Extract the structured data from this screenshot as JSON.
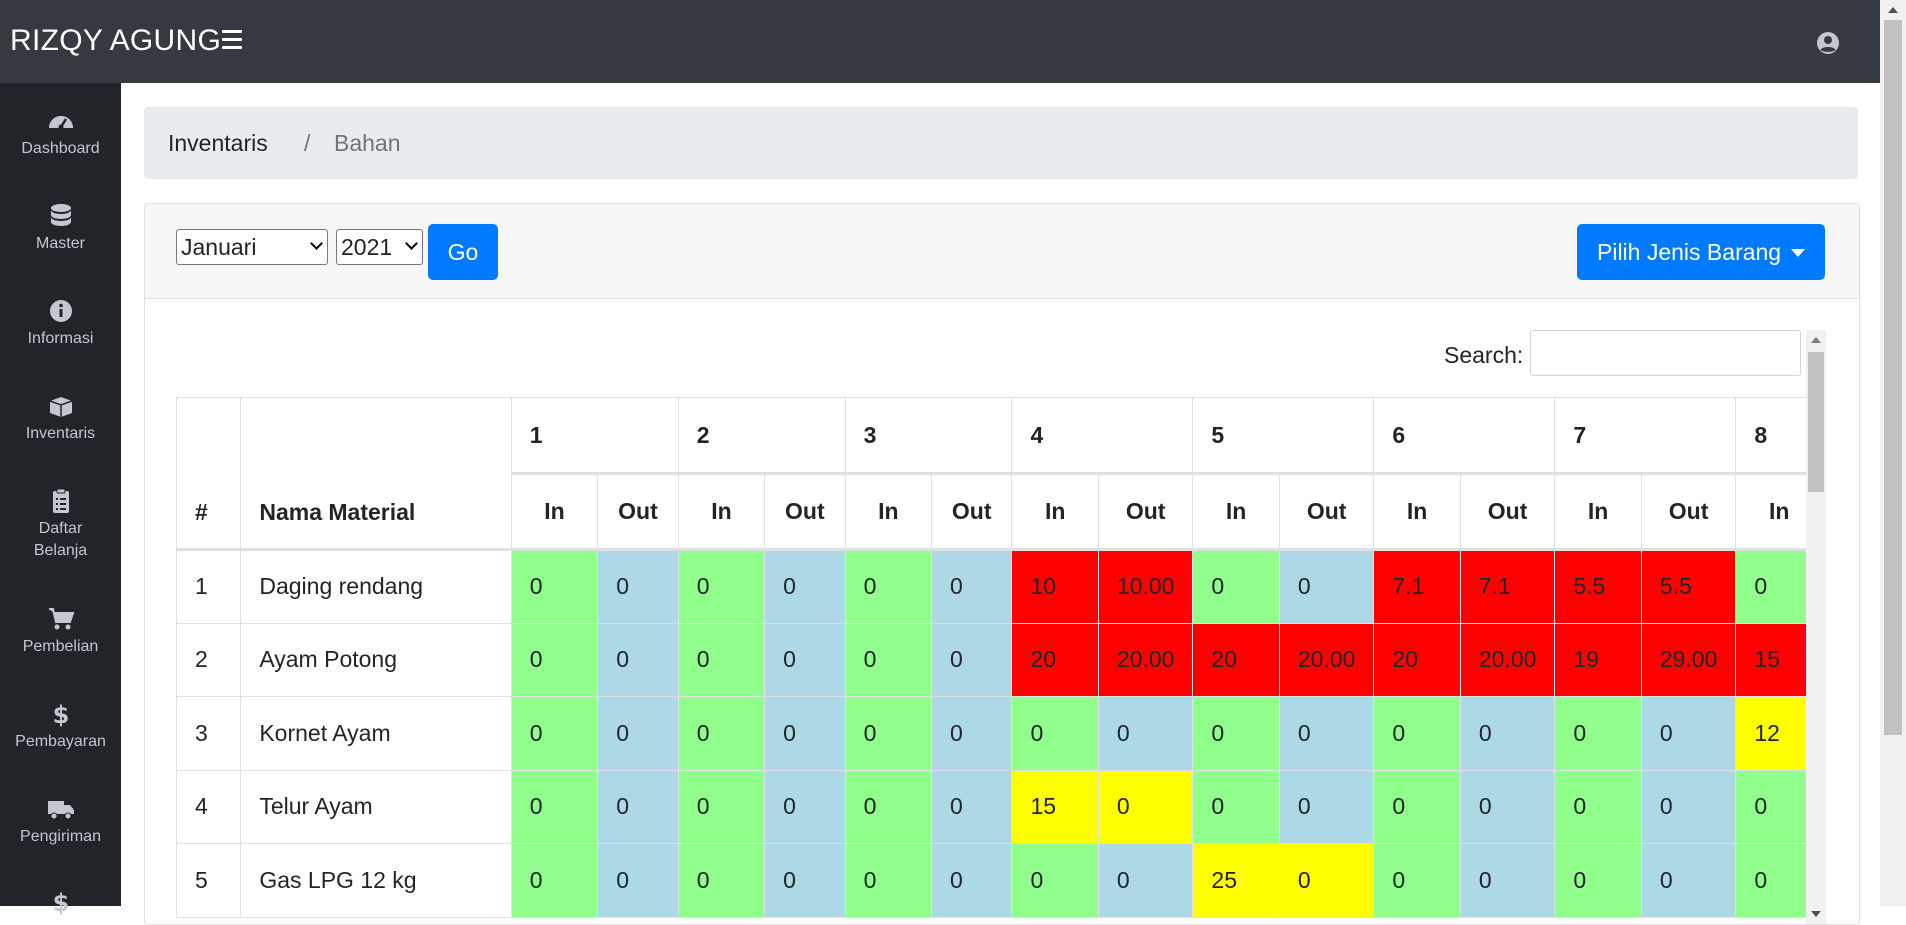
{
  "app": {
    "brand": "RIZQY AGUNG"
  },
  "sidebar": {
    "items": [
      {
        "label": "Dashboard",
        "icon": "tachometer-icon"
      },
      {
        "label": "Master",
        "icon": "database-icon"
      },
      {
        "label": "Informasi",
        "icon": "info-icon"
      },
      {
        "label": "Inventaris",
        "icon": "boxes-icon"
      },
      {
        "label": "Daftar Belanja",
        "icon": "clipboard-list-icon"
      },
      {
        "label": "Pembelian",
        "icon": "cart-icon"
      },
      {
        "label": "Pembayaran",
        "icon": "dollar-icon"
      },
      {
        "label": "Pengiriman",
        "icon": "truck-icon"
      }
    ]
  },
  "breadcrumb": {
    "items": [
      "Inventaris",
      "Bahan"
    ],
    "separator": "/"
  },
  "filters": {
    "month": "Januari",
    "year": "2021",
    "go_label": "Go",
    "pilih_label": "Pilih Jenis Barang"
  },
  "search": {
    "label": "Search:",
    "value": ""
  },
  "table": {
    "col_index": "#",
    "col_name": "Nama Material",
    "days": [
      "1",
      "2",
      "3",
      "4",
      "5",
      "6",
      "7",
      "8"
    ],
    "in_label": "In",
    "out_label": "Out",
    "rows": [
      {
        "no": "1",
        "name": "Daging rendang",
        "cells": [
          "0",
          "0",
          "0",
          "0",
          "0",
          "0",
          "10",
          "10.00",
          "0",
          "0",
          "7.1",
          "7.1",
          "5.5",
          "5.5",
          "0"
        ]
      },
      {
        "no": "2",
        "name": "Ayam Potong",
        "cells": [
          "0",
          "0",
          "0",
          "0",
          "0",
          "0",
          "20",
          "20.00",
          "20",
          "20.00",
          "20",
          "20.00",
          "19",
          "29.00",
          "15"
        ]
      },
      {
        "no": "3",
        "name": "Kornet Ayam",
        "cells": [
          "0",
          "0",
          "0",
          "0",
          "0",
          "0",
          "0",
          "0",
          "0",
          "0",
          "0",
          "0",
          "0",
          "0",
          "12"
        ]
      },
      {
        "no": "4",
        "name": "Telur Ayam",
        "cells": [
          "0",
          "0",
          "0",
          "0",
          "0",
          "0",
          "15",
          "0",
          "0",
          "0",
          "0",
          "0",
          "0",
          "0",
          "0"
        ]
      },
      {
        "no": "5",
        "name": "Gas LPG 12 kg",
        "cells": [
          "0",
          "0",
          "0",
          "0",
          "0",
          "0",
          "0",
          "0",
          "25",
          "0",
          "0",
          "0",
          "0",
          "0",
          "0"
        ]
      }
    ],
    "colors": {
      "green": "#90ff8c",
      "blue": "#add8e6",
      "red": "#ff0000",
      "yellow": "#ffff00"
    }
  }
}
